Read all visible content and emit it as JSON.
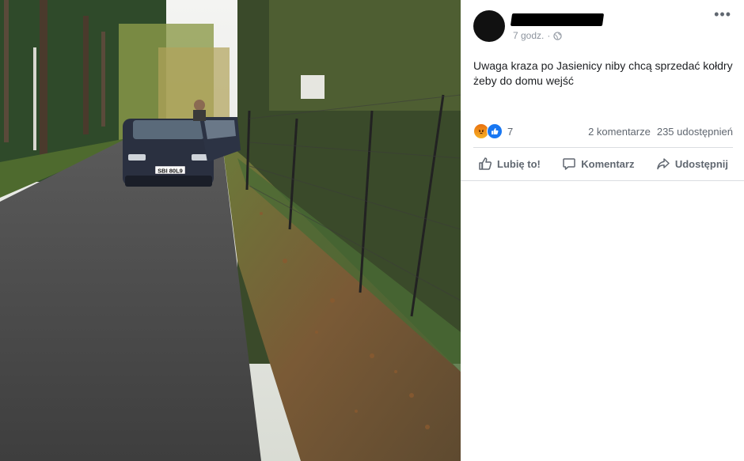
{
  "post": {
    "time": "7 godz.",
    "more_label": "•••",
    "text": "Uwaga kraza po Jasienicy niby chcą sprzedać kołdry żeby do domu wejść",
    "reaction_count": "7",
    "comments": "2 komentarze",
    "shares": "235 udostępnień"
  },
  "actions": {
    "like": "Lubię to!",
    "comment": "Komentarz",
    "share": "Udostępnij"
  },
  "photo": {
    "plate": "SBI 80L9"
  },
  "colors": {
    "accent": "#1877f2",
    "secondary_text": "#606770"
  }
}
